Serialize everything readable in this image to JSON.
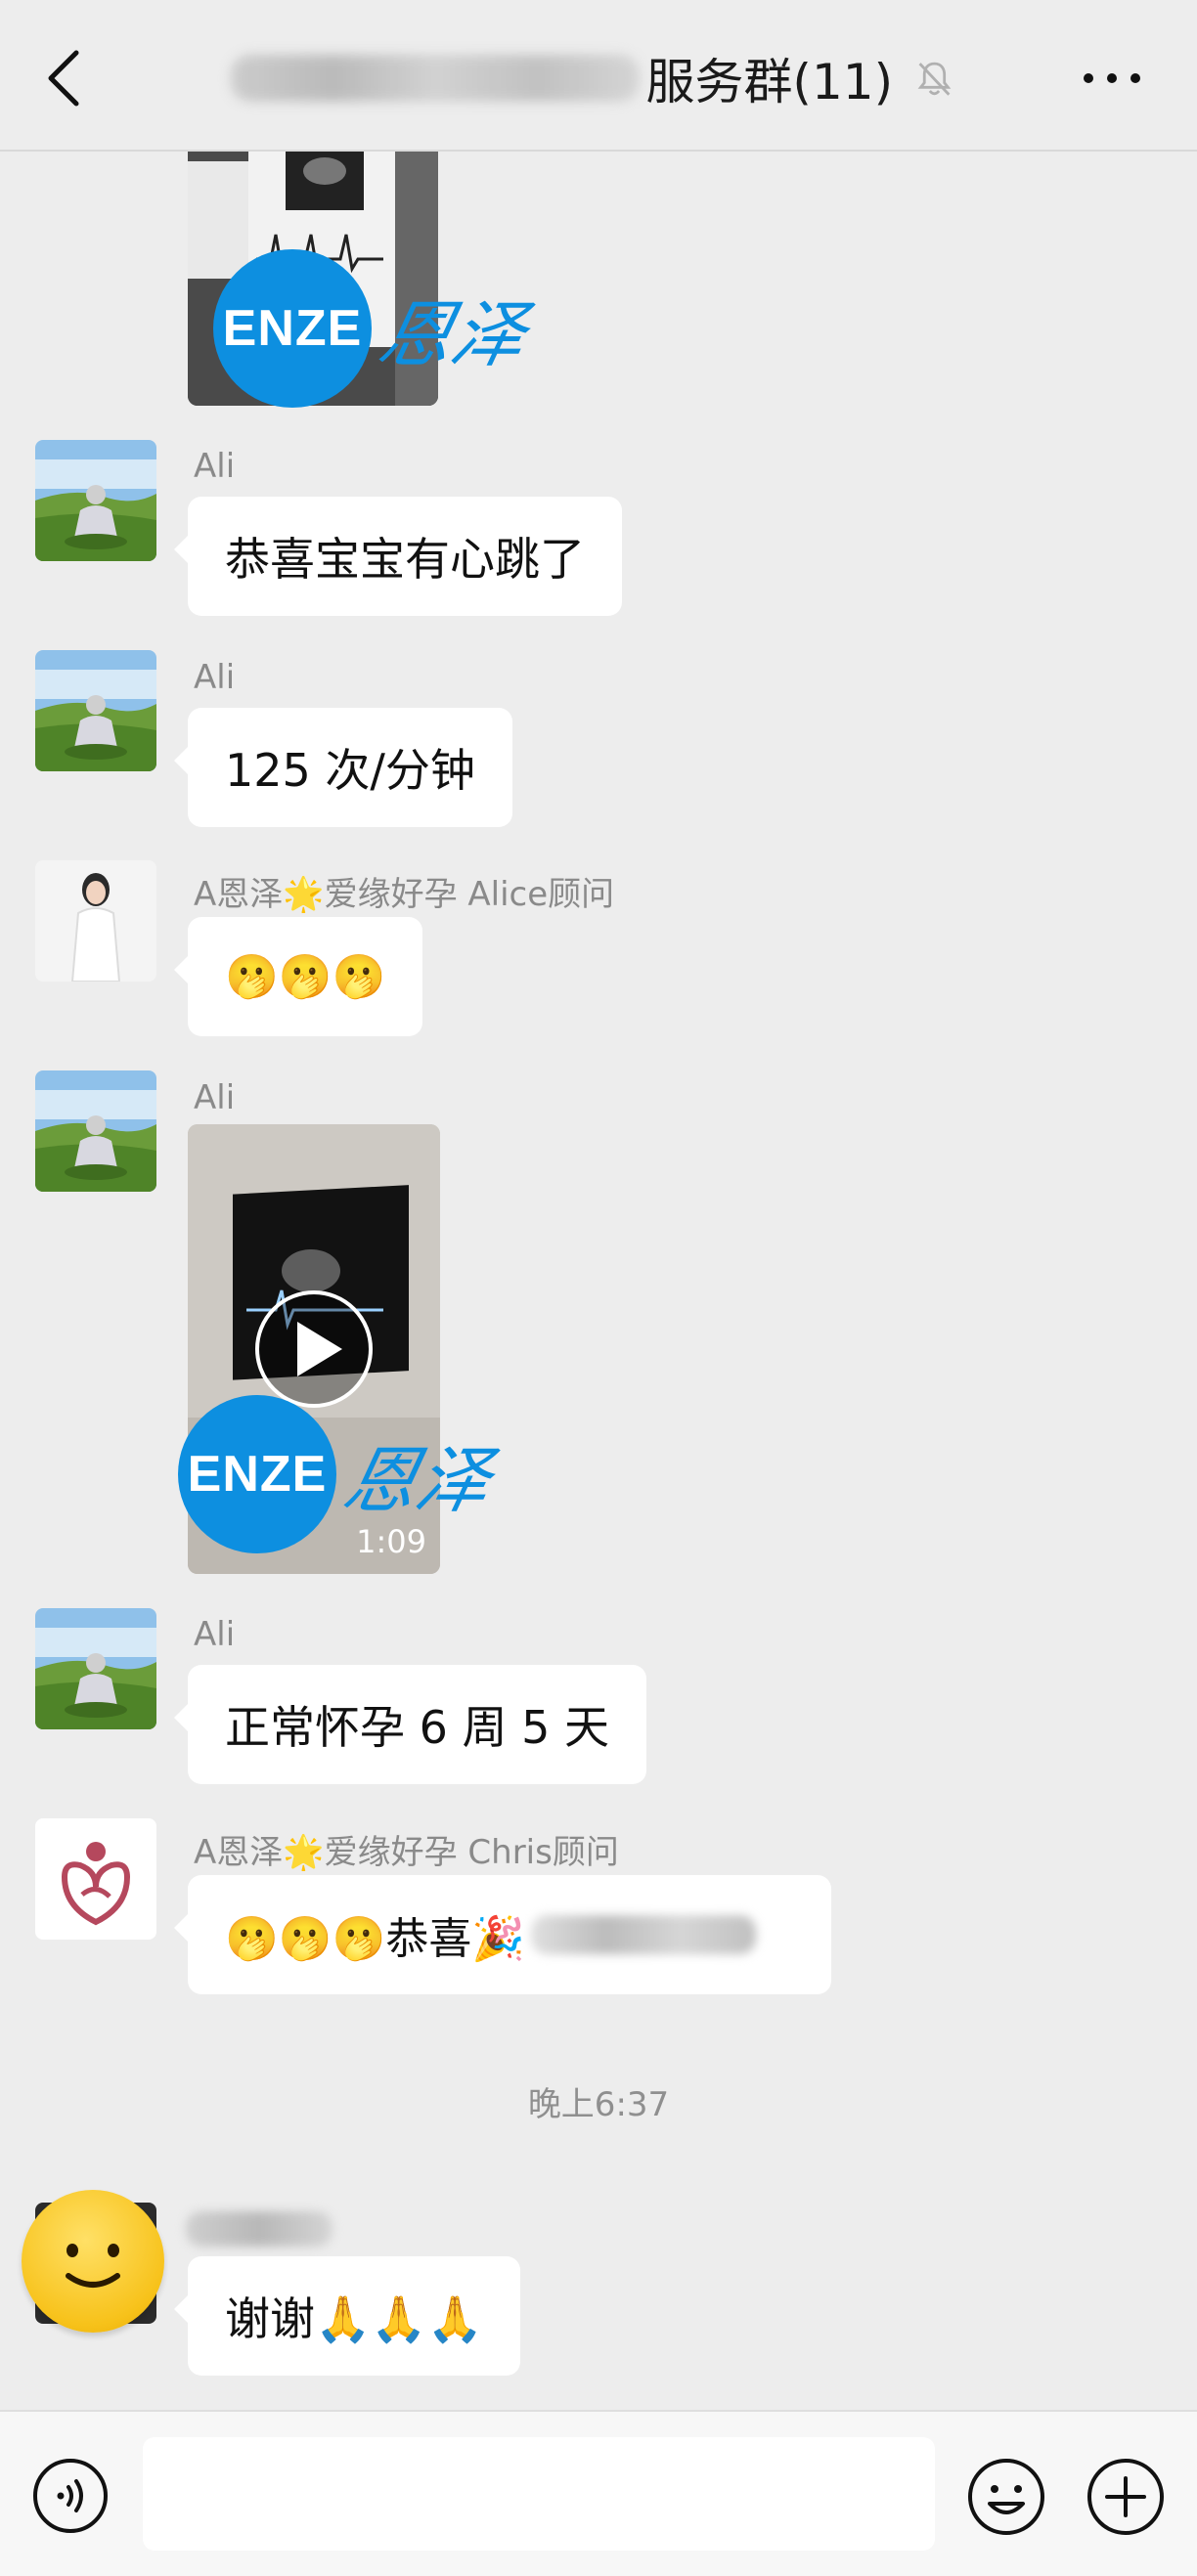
{
  "header": {
    "title_suffix": "服务群(11)"
  },
  "messages": [
    {
      "sender": "Ali",
      "text": "恭喜宝宝有心跳了"
    },
    {
      "sender": "Ali",
      "text": "125 次/分钟"
    },
    {
      "sender": "A恩泽🌟爱缘好孕 Alice顾问",
      "text": "🫢🫢🫢"
    },
    {
      "sender": "Ali",
      "video_duration": "1:09"
    },
    {
      "sender": "Ali",
      "text": "正常怀孕 6 周 5 天"
    },
    {
      "sender": "A恩泽🌟爱缘好孕 Chris顾问",
      "text": "🫢🫢🫢恭喜🎉"
    },
    {
      "text": "谢谢🙏🙏🙏"
    }
  ],
  "timestamp": "晚上6:37",
  "watermark": {
    "badge": "ENZE",
    "script": "恩泽"
  },
  "colors": {
    "background": "#ededed",
    "bubble": "#ffffff",
    "accent": "#0d8fe0"
  },
  "icons": [
    "back-icon",
    "mute-bell-icon",
    "more-icon",
    "voice-icon",
    "emoji-icon",
    "plus-icon",
    "play-icon"
  ]
}
